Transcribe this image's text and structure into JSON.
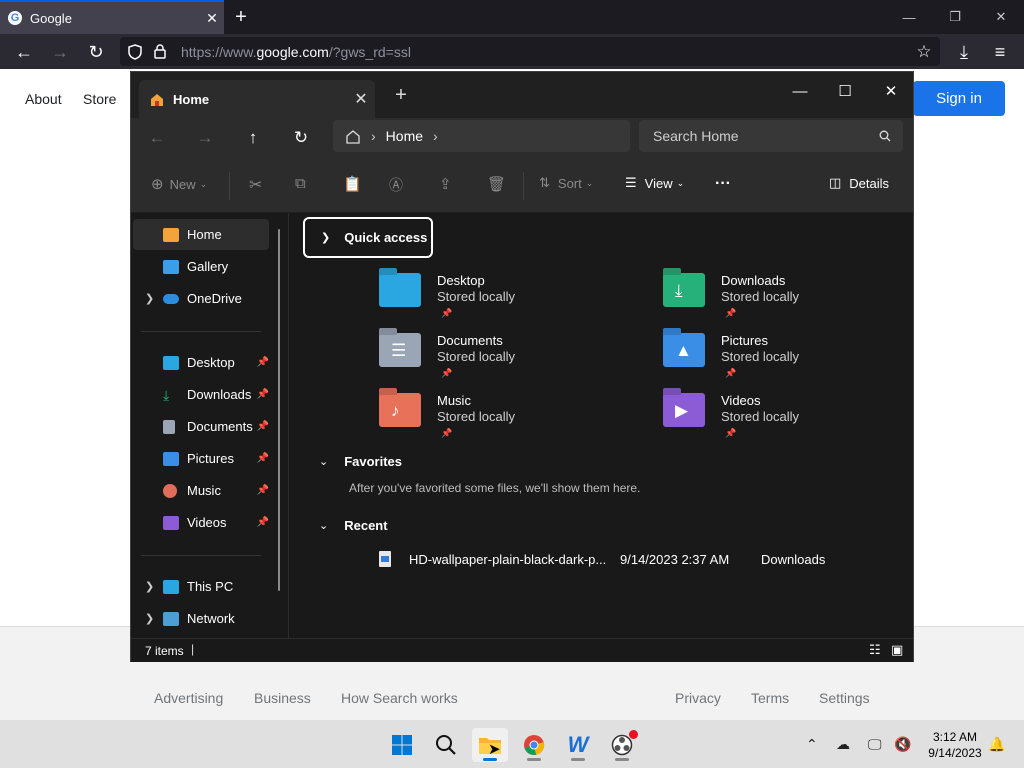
{
  "browser": {
    "tab_title": "Google",
    "tab_close": "✕",
    "new_tab": "+",
    "url_prefix": "https://www.",
    "url_domain": "google.com",
    "url_suffix": "/?gws_rd=ssl"
  },
  "google": {
    "about": "About",
    "store": "Store",
    "sign_in": "Sign in",
    "footer_left": [
      "Advertising",
      "Business",
      "How Search works"
    ],
    "footer_right": [
      "Privacy",
      "Terms",
      "Settings"
    ]
  },
  "explorer": {
    "tab_label": "Home",
    "path_crumb": "Home",
    "search_placeholder": "Search Home",
    "toolbar": {
      "new": "New",
      "sort": "Sort",
      "view": "View",
      "more": "···",
      "details": "Details"
    },
    "nav": {
      "home": "Home",
      "gallery": "Gallery",
      "onedrive": "OneDrive",
      "desktop": "Desktop",
      "downloads": "Downloads",
      "documents": "Documents",
      "pictures": "Pictures",
      "music": "Music",
      "videos": "Videos",
      "thispc": "This PC",
      "network": "Network"
    },
    "quick_access": "Quick access",
    "tiles": [
      {
        "name": "Desktop",
        "sub": "Stored locally"
      },
      {
        "name": "Downloads",
        "sub": "Stored locally"
      },
      {
        "name": "Documents",
        "sub": "Stored locally"
      },
      {
        "name": "Pictures",
        "sub": "Stored locally"
      },
      {
        "name": "Music",
        "sub": "Stored locally"
      },
      {
        "name": "Videos",
        "sub": "Stored locally"
      }
    ],
    "favorites": "Favorites",
    "favorites_empty": "After you've favorited some files, we'll show them here.",
    "recent": "Recent",
    "recent_file": {
      "name": "HD-wallpaper-plain-black-dark-p...",
      "date": "9/14/2023 2:37 AM",
      "location": "Downloads"
    },
    "status_items": "7 items"
  },
  "taskbar": {
    "time": "3:12 AM",
    "date": "9/14/2023"
  }
}
